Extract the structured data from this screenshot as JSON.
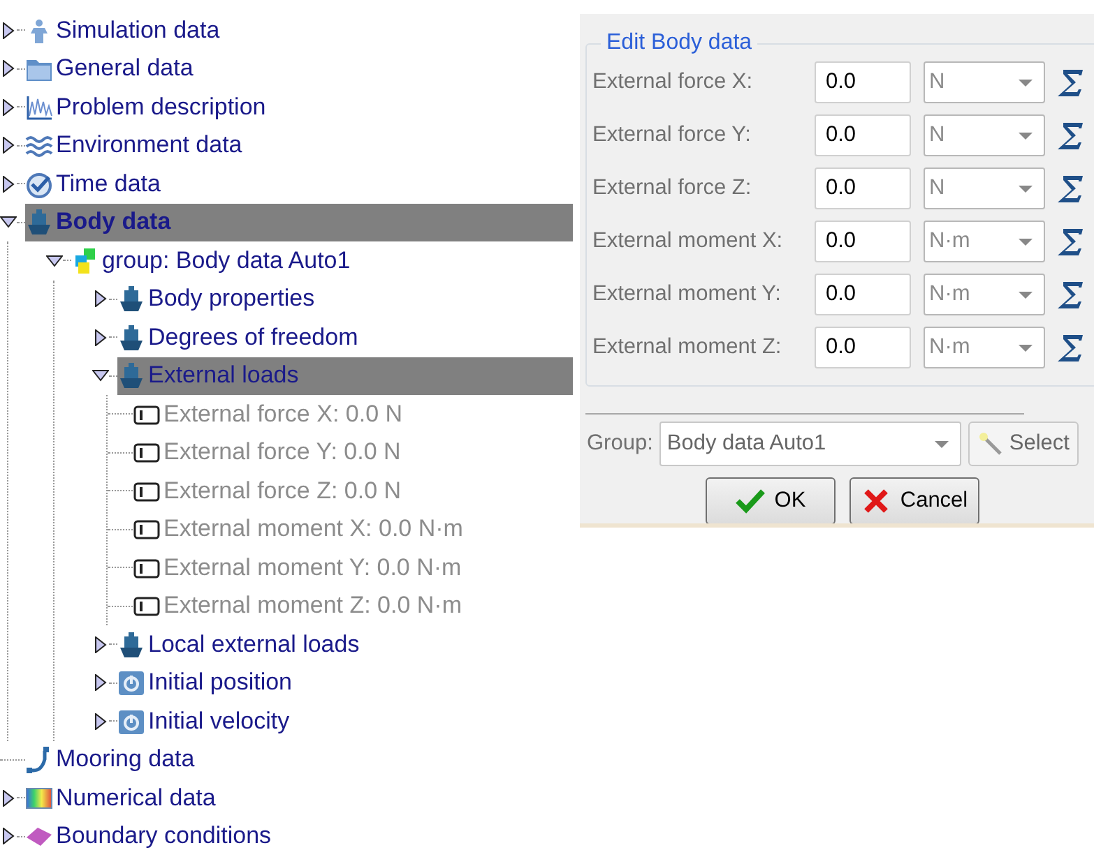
{
  "tree": [
    {
      "label": "Simulation data",
      "kind": "figure",
      "expanded": false,
      "selected": false,
      "bold": false
    },
    {
      "label": "General data",
      "kind": "folder",
      "expanded": false,
      "selected": false,
      "bold": false
    },
    {
      "label": "Problem description",
      "kind": "chart",
      "expanded": false,
      "selected": false,
      "bold": false
    },
    {
      "label": "Environment data",
      "kind": "waves",
      "expanded": false,
      "selected": false,
      "bold": false
    },
    {
      "label": "Time data",
      "kind": "clock",
      "expanded": false,
      "selected": false,
      "bold": false
    },
    {
      "label": "Body data",
      "kind": "ship",
      "expanded": true,
      "selected": true,
      "bold": true,
      "children": [
        {
          "label": "group: Body data Auto1",
          "kind": "cubes",
          "expanded": true,
          "selected": false,
          "bold": false,
          "children": [
            {
              "label": "Body properties",
              "kind": "ship",
              "expanded": false,
              "selected": false,
              "bold": false
            },
            {
              "label": "Degrees of freedom",
              "kind": "ship",
              "expanded": false,
              "selected": false,
              "bold": false
            },
            {
              "label": "External loads",
              "kind": "ship",
              "expanded": true,
              "selected": true,
              "bold": false,
              "children": [
                {
                  "label": "External force X: 0.0 N",
                  "kind": "field",
                  "selected": false,
                  "bold": false,
                  "disabled": true
                },
                {
                  "label": "External force Y: 0.0 N",
                  "kind": "field",
                  "selected": false,
                  "bold": false,
                  "disabled": true
                },
                {
                  "label": "External force Z: 0.0 N",
                  "kind": "field",
                  "selected": false,
                  "bold": false,
                  "disabled": true
                },
                {
                  "label": "External moment X: 0.0 N·m",
                  "kind": "field",
                  "selected": false,
                  "bold": false,
                  "disabled": true
                },
                {
                  "label": "External moment Y: 0.0 N·m",
                  "kind": "field",
                  "selected": false,
                  "bold": false,
                  "disabled": true
                },
                {
                  "label": "External moment Z: 0.0 N·m",
                  "kind": "field",
                  "selected": false,
                  "bold": false,
                  "disabled": true
                }
              ]
            },
            {
              "label": "Local external loads",
              "kind": "ship",
              "expanded": false,
              "selected": false,
              "bold": false
            },
            {
              "label": "Initial position",
              "kind": "reset",
              "expanded": false,
              "selected": false,
              "bold": false
            },
            {
              "label": "Initial velocity",
              "kind": "reset",
              "expanded": false,
              "selected": false,
              "bold": false
            }
          ]
        }
      ]
    },
    {
      "label": "Mooring data",
      "kind": "mooring",
      "selected": false,
      "bold": false
    },
    {
      "label": "Numerical data",
      "kind": "gradient",
      "expanded": false,
      "selected": false,
      "bold": false
    },
    {
      "label": "Boundary conditions",
      "kind": "surface",
      "expanded": false,
      "selected": false,
      "bold": false
    }
  ],
  "dialog": {
    "title": "Edit Body data",
    "fields": [
      {
        "label": "External force X:",
        "value": "0.0",
        "unit": "N"
      },
      {
        "label": "External force Y:",
        "value": "0.0",
        "unit": "N"
      },
      {
        "label": "External force Z:",
        "value": "0.0",
        "unit": "N"
      },
      {
        "label": "External moment X:",
        "value": "0.0",
        "unit": "N·m"
      },
      {
        "label": "External moment Y:",
        "value": "0.0",
        "unit": "N·m"
      },
      {
        "label": "External moment Z:",
        "value": "0.0",
        "unit": "N·m"
      }
    ],
    "group": {
      "label": "Group:",
      "value": "Body data Auto1"
    },
    "select_button": "Select",
    "buttons": [
      {
        "kind": "ok",
        "label": "OK"
      },
      {
        "kind": "cancel",
        "label": "Cancel"
      }
    ]
  }
}
